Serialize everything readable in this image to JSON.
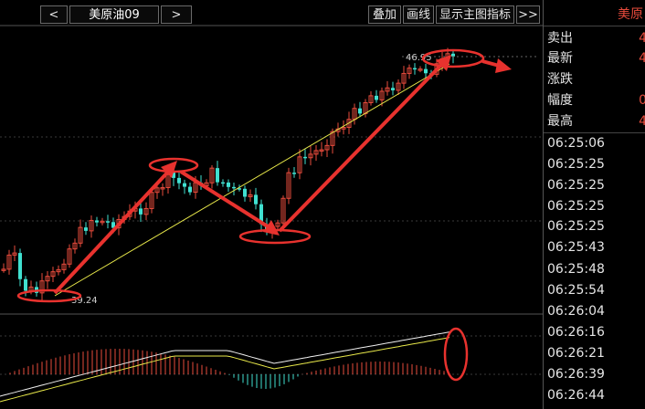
{
  "toolbar": {
    "prev_label": "<",
    "instrument": "美原油09",
    "next_label": ">",
    "overlay_label": "叠加",
    "draw_label": "画线",
    "show_indicator_label": "显示主图指标",
    "more_label": ">>"
  },
  "quote_panel": {
    "title": "美原",
    "rows": [
      {
        "label": "卖出",
        "value": "4"
      },
      {
        "label": "最新",
        "value": "4"
      },
      {
        "label": "涨跌",
        "value": ""
      },
      {
        "label": "幅度",
        "value": "0"
      },
      {
        "label": "最高",
        "value": "4"
      }
    ]
  },
  "trade_times": [
    "06:25:06",
    "06:25:25",
    "06:25:25",
    "06:25:25",
    "06:25:25",
    "06:25:43",
    "06:25:48",
    "06:25:54",
    "06:26:04",
    "06:26:16",
    "06:26:21",
    "06:26:39",
    "06:26:44"
  ],
  "chart_annotations": {
    "high_label": "46.95",
    "low_label": "39.24"
  },
  "colors": {
    "up": "#e84b3c",
    "down": "#40e0d0",
    "trend": "#e8e84a",
    "annotation": "#e8322e",
    "grid": "#3a3a3a"
  }
}
